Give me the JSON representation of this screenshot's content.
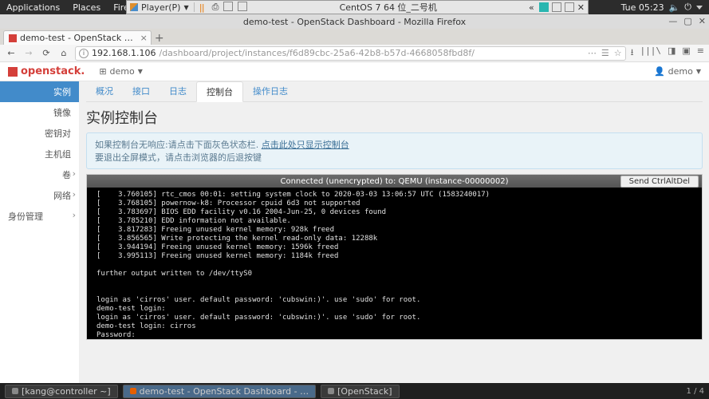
{
  "gnome": {
    "apps": "Applications",
    "places": "Places",
    "firefox": "Firefox",
    "clock": "Tue 05:23"
  },
  "vmware": {
    "player_label": "Player(P)",
    "os_label": "CentOS 7 64 位_二号机",
    "chev": "«"
  },
  "firefox": {
    "window_title": "demo-test - OpenStack Dashboard - Mozilla Firefox",
    "tab_title": "demo-test - OpenStack …",
    "url_host": "192.168.1.106",
    "url_path": "/dashboard/project/instances/f6d89cbc-25a6-42b8-b57d-4668058fbd8f/"
  },
  "openstack": {
    "brand": "openstack.",
    "project_label": "demo",
    "user_label": "demo",
    "sidebar": {
      "instances": "实例",
      "images": "镜像",
      "keypairs": "密钥对",
      "server_groups": "主机组",
      "volumes": "卷",
      "networks": "网络",
      "identity": "身份管理"
    },
    "tabs": {
      "overview": "概况",
      "interfaces": "接口",
      "log": "日志",
      "console": "控制台",
      "action_log": "操作日志"
    },
    "page_title": "实例控制台",
    "alert_line1_a": "如果控制台无响应:请点击下面灰色状态栏. ",
    "alert_line1_link": "点击此处只显示控制台",
    "alert_line2": "要退出全屏模式，请点击浏览器的后退按键",
    "console": {
      "status": "Connected (unencrypted) to: QEMU (instance-00000002)",
      "button": "Send CtrlAltDel",
      "output": "[    3.760105] rtc_cmos 00:01: setting system clock to 2020-03-03 13:06:57 UTC (1583240017)\n[    3.768105] powernow-k8: Processor cpuid 6d3 not supported\n[    3.783697] BIOS EDD facility v0.16 2004-Jun-25, 0 devices found\n[    3.785210] EDD information not available.\n[    3.817283] Freeing unused kernel memory: 928k freed\n[    3.856565] Write protecting the kernel read-only data: 12288k\n[    3.944194] Freeing unused kernel memory: 1596k freed\n[    3.995113] Freeing unused kernel memory: 1184k freed\n\nfurther output written to /dev/ttyS0\n\n\nlogin as 'cirros' user. default password: 'cubswin:)'. use 'sudo' for root.\ndemo-test login:\nlogin as 'cirros' user. default password: 'cubswin:)'. use 'sudo' for root.\ndemo-test login: cirros\nPassword:\n$\n$ ls\n$ pwd\n/home/cirros\n$\n$ _"
    }
  },
  "taskbar": {
    "terminal": "[kang@controller ~]",
    "firefox": "demo-test - OpenStack Dashboard - …",
    "other": "[OpenStack]",
    "workspace": "1 / 4"
  }
}
